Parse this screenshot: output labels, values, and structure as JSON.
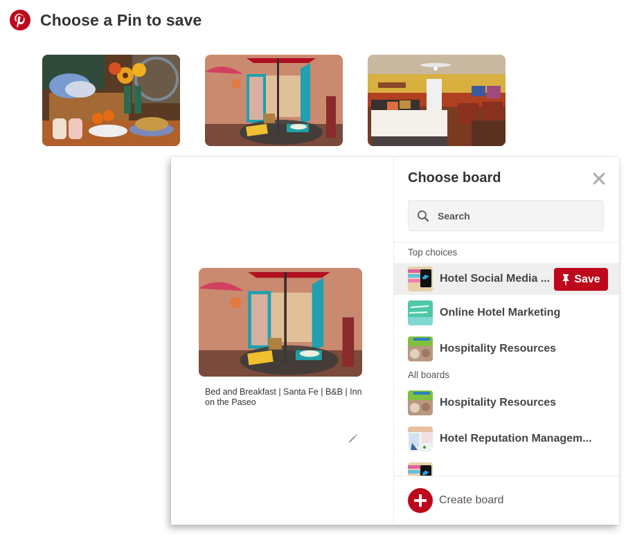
{
  "header": {
    "logo": "pinterest-logo-icon",
    "title": "Choose a Pin to save",
    "brand_color": "#bd081c"
  },
  "pins": [
    {
      "subject": "picnic basket with sunflowers, fruit and sandwiches",
      "selected": false
    },
    {
      "subject": "patio with turquoise doors and breakfast table",
      "selected": true
    },
    {
      "subject": "hotel bedroom with yellow walls",
      "selected": false
    }
  ],
  "preview": {
    "description": "Bed and Breakfast | Santa Fe | B&B | Inn on the Paseo",
    "edit_icon": "pencil-icon"
  },
  "board_picker": {
    "title": "Choose board",
    "close_icon": "close-icon",
    "search": {
      "placeholder": "Search",
      "value": "",
      "icon": "search-icon"
    },
    "sections": [
      {
        "label": "Top choices",
        "boards": [
          {
            "name": "Hotel Social Media ...",
            "highlighted": true
          },
          {
            "name": "Online Hotel Marketing",
            "highlighted": false
          },
          {
            "name": "Hospitality Resources",
            "highlighted": false
          }
        ]
      },
      {
        "label": "All boards",
        "boards": [
          {
            "name": "Hospitality Resources",
            "highlighted": false
          },
          {
            "name": "Hotel Reputation Managem...",
            "highlighted": false
          },
          {
            "name": "",
            "highlighted": false
          }
        ]
      }
    ],
    "save_button": {
      "label": "Save",
      "icon": "pushpin-icon",
      "color": "#bd081c"
    },
    "create_board": {
      "label": "Create board",
      "icon": "plus-icon"
    }
  }
}
